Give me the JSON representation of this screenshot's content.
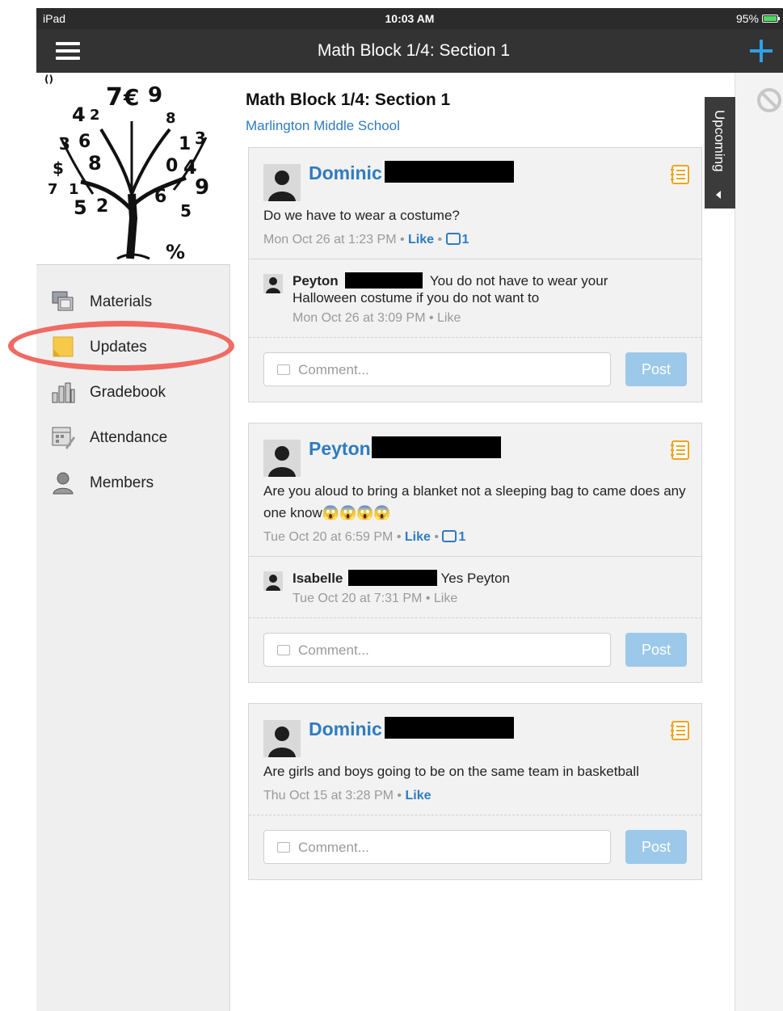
{
  "status_bar": {
    "device": "iPad",
    "time": "10:03 AM",
    "battery": "95%"
  },
  "nav": {
    "title": "Math Block 1/4: Section 1"
  },
  "sidebar": {
    "items": [
      {
        "label": "Materials",
        "icon": "materials-icon"
      },
      {
        "label": "Updates",
        "icon": "updates-icon",
        "active": true
      },
      {
        "label": "Gradebook",
        "icon": "gradebook-icon"
      },
      {
        "label": "Attendance",
        "icon": "attendance-icon"
      },
      {
        "label": "Members",
        "icon": "members-icon"
      }
    ]
  },
  "main": {
    "title": "Math Block 1/4: Section 1",
    "school": "Marlington Middle School",
    "posts": [
      {
        "author": "Dominic",
        "body": "Do we have to wear a costume?",
        "time": "Mon Oct 26 at 1:23 PM",
        "like": "Like",
        "comments": "1",
        "reply": {
          "author": "Peyton",
          "text": "You do not have to wear your Halloween costume if you do not want to",
          "time": "Mon Oct 26 at 3:09 PM",
          "like": "Like"
        },
        "comment_placeholder": "Comment...",
        "post_label": "Post"
      },
      {
        "author": "Peyton",
        "body": "Are you aloud to bring a blanket not a sleeping bag to came does any one know😱😱😱😱",
        "time": "Tue Oct 20 at 6:59 PM",
        "like": "Like",
        "comments": "1",
        "reply": {
          "author": "Isabelle",
          "text": "Yes Peyton",
          "time": "Tue Oct 20 at 7:31 PM",
          "like": "Like"
        },
        "comment_placeholder": "Comment...",
        "post_label": "Post"
      },
      {
        "author": "Dominic",
        "body": "Are girls and boys going to be on the same team in basketball",
        "time": "Thu Oct 15 at 3:28 PM",
        "like": "Like",
        "comment_placeholder": "Comment...",
        "post_label": "Post"
      }
    ]
  },
  "right_panel": {
    "upcoming": "Upcoming"
  },
  "colors": {
    "accent": "#2f7bc0",
    "nav": "#333333",
    "post_button": "#9cc9ea",
    "highlight": "#ef6b63"
  }
}
